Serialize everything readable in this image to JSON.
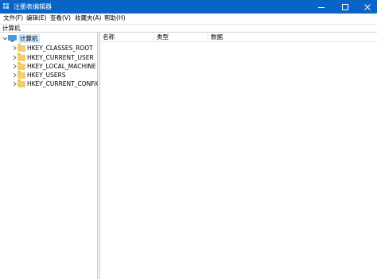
{
  "window": {
    "title": "注册表编辑器",
    "icon": "registry-editor-icon",
    "controls": {
      "minimize": "minimize-icon",
      "maximize": "maximize-icon",
      "close": "close-icon"
    }
  },
  "menu": {
    "file": "文件(F)",
    "edit": "编辑(E)",
    "view": "查看(V)",
    "favorites": "收藏夹(A)",
    "help": "帮助(H)"
  },
  "address": {
    "path": "计算机"
  },
  "tree": {
    "root": {
      "label": "计算机",
      "icon": "computer-icon",
      "expanded": true
    },
    "items": [
      {
        "label": "HKEY_CLASSES_ROOT",
        "icon": "folder-icon"
      },
      {
        "label": "HKEY_CURRENT_USER",
        "icon": "folder-icon"
      },
      {
        "label": "HKEY_LOCAL_MACHINE",
        "icon": "folder-icon"
      },
      {
        "label": "HKEY_USERS",
        "icon": "folder-icon"
      },
      {
        "label": "HKEY_CURRENT_CONFIG",
        "icon": "folder-icon"
      }
    ]
  },
  "list": {
    "columns": {
      "name": "名称",
      "type": "类型",
      "data": "数据"
    }
  },
  "colors": {
    "titlebar": "#0a64c6",
    "selection": "#cde8ff",
    "folder": "#f3cd6a"
  }
}
